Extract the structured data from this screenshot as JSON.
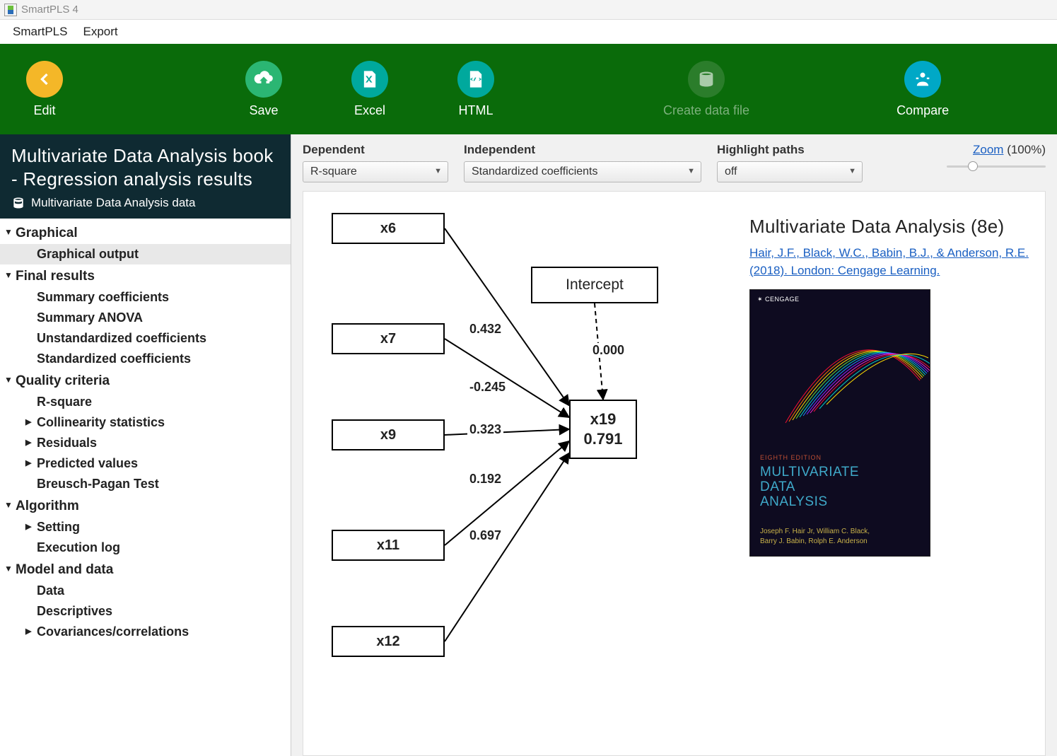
{
  "app": {
    "title": "SmartPLS 4"
  },
  "menu": {
    "items": [
      "SmartPLS",
      "Export"
    ]
  },
  "toolbar": [
    {
      "id": "edit",
      "label": "Edit",
      "icon": "arrow-left-icon",
      "circ": "orange",
      "disabled": false
    },
    {
      "id": "save",
      "label": "Save",
      "icon": "cloud-up-icon",
      "circ": "green",
      "disabled": false
    },
    {
      "id": "excel",
      "label": "Excel",
      "icon": "excel-icon",
      "circ": "teal",
      "disabled": false
    },
    {
      "id": "html",
      "label": "HTML",
      "icon": "html-icon",
      "circ": "teal",
      "disabled": false
    },
    {
      "id": "create",
      "label": "Create data file",
      "icon": "db-icon",
      "circ": "dim",
      "disabled": true
    },
    {
      "id": "compare",
      "label": "Compare",
      "icon": "compare-icon",
      "circ": "cyan",
      "disabled": false
    }
  ],
  "sidebar": {
    "title": "Multivariate Data Analysis book - Regression analysis results",
    "subtitle": "Multivariate Data Analysis data",
    "sections": [
      {
        "label": "Graphical",
        "items": [
          {
            "label": "Graphical output",
            "active": true
          }
        ]
      },
      {
        "label": "Final results",
        "items": [
          {
            "label": "Summary coefficients"
          },
          {
            "label": "Summary ANOVA"
          },
          {
            "label": "Unstandardized coefficients"
          },
          {
            "label": "Standardized coefficients"
          }
        ]
      },
      {
        "label": "Quality criteria",
        "items": [
          {
            "label": "R-square"
          },
          {
            "label": "Collinearity statistics",
            "exp": true
          },
          {
            "label": "Residuals",
            "exp": true
          },
          {
            "label": "Predicted values",
            "exp": true
          },
          {
            "label": "Breusch-Pagan Test"
          }
        ]
      },
      {
        "label": "Algorithm",
        "items": [
          {
            "label": "Setting",
            "exp": true
          },
          {
            "label": "Execution log"
          }
        ]
      },
      {
        "label": "Model and data",
        "items": [
          {
            "label": "Data"
          },
          {
            "label": "Descriptives"
          },
          {
            "label": "Covariances/correlations",
            "exp": true
          }
        ]
      }
    ]
  },
  "controls": {
    "dependent": {
      "label": "Dependent",
      "value": "R-square"
    },
    "independent": {
      "label": "Independent",
      "value": "Standardized coefficients"
    },
    "highlight": {
      "label": "Highlight paths",
      "value": "off"
    },
    "zoom": {
      "link": "Zoom",
      "pct": "(100%)"
    }
  },
  "diagram": {
    "intercept": {
      "label": "Intercept",
      "coef": "0.000"
    },
    "target": {
      "name": "x19",
      "rsq": "0.791"
    },
    "predictors": [
      {
        "name": "x6",
        "coef": "0.432"
      },
      {
        "name": "x7",
        "coef": "-0.245"
      },
      {
        "name": "x9",
        "coef": "0.323"
      },
      {
        "name": "x11",
        "coef": "0.192"
      },
      {
        "name": "x12",
        "coef": "0.697"
      }
    ]
  },
  "info": {
    "title": "Multivariate Data Analysis (8e)",
    "citation": "Hair, J.F., Black, W.C., Babin, B.J., & Anderson, R.E. (2018).  London: Cengage Learning.",
    "book": {
      "brand": "CENGAGE",
      "edition": "EIGHTH EDITION",
      "title_l1": "MULTIVARIATE",
      "title_l2": "DATA",
      "title_l3": "ANALYSIS",
      "authors_l1": "Joseph F. Hair Jr, William C. Black,",
      "authors_l2": "Barry J. Babin, Rolph E. Anderson"
    }
  },
  "chart_data": {
    "type": "path-diagram",
    "dependent": "x19",
    "r_square": 0.791,
    "coefficients_type": "Standardized coefficients",
    "paths": [
      {
        "from": "x6",
        "to": "x19",
        "coef": 0.432
      },
      {
        "from": "x7",
        "to": "x19",
        "coef": -0.245
      },
      {
        "from": "x9",
        "to": "x19",
        "coef": 0.323
      },
      {
        "from": "x11",
        "to": "x19",
        "coef": 0.192
      },
      {
        "from": "x12",
        "to": "x19",
        "coef": 0.697
      },
      {
        "from": "Intercept",
        "to": "x19",
        "coef": 0.0
      }
    ]
  }
}
